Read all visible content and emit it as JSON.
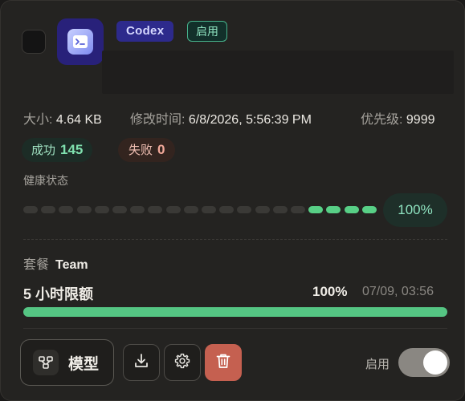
{
  "account": {
    "provider_tag": "Codex",
    "status_tag": "启用"
  },
  "meta": {
    "size_label": "大小:",
    "size_value": "4.64 KB",
    "modified_label": "修改时间:",
    "modified_value": "6/8/2026, 5:56:39 PM",
    "priority_label": "优先级:",
    "priority_value": "9999"
  },
  "stats": {
    "success_label": "成功",
    "success_count": "145",
    "fail_label": "失败",
    "fail_count": "0"
  },
  "health": {
    "label": "健康状态",
    "percent_text": "100%",
    "segments_total": 20,
    "segments_active": 4
  },
  "plan": {
    "label": "套餐",
    "value": "Team"
  },
  "quota": {
    "label": "5 小时限额",
    "percent_text": "100%",
    "reset_time": "07/09, 03:56",
    "fraction": 1.0
  },
  "actions": {
    "model_button": "模型",
    "download_icon": "download-icon",
    "settings_icon": "gear-icon",
    "delete_icon": "trash-icon",
    "toggle_label": "启用",
    "toggle_on": true
  },
  "colors": {
    "brand": "#2d2a8c",
    "success": "#58cf86",
    "danger": "#c56050"
  }
}
